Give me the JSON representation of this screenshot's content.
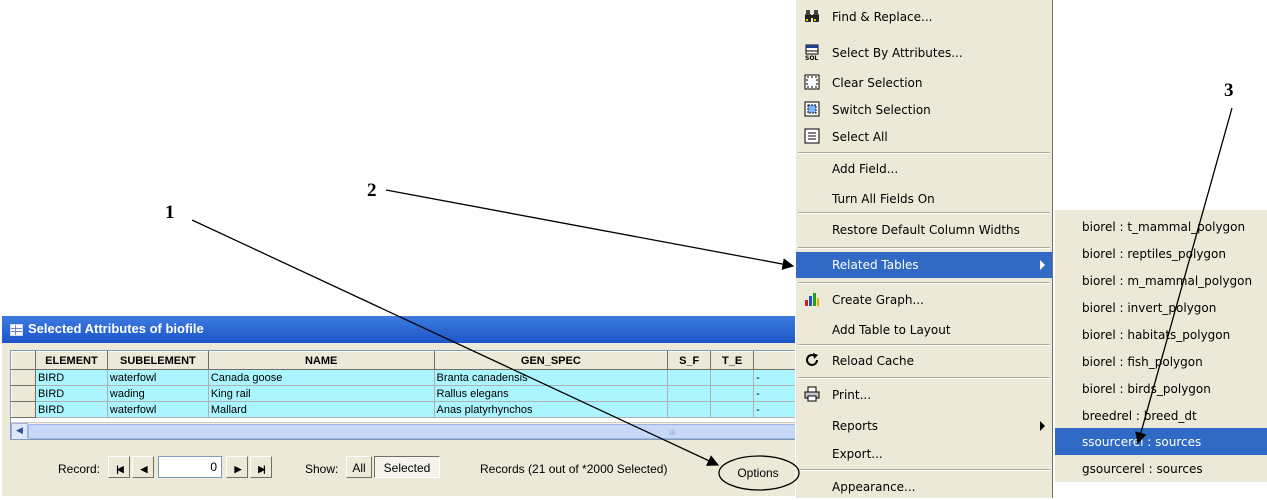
{
  "callouts": {
    "one": "1",
    "two": "2",
    "three": "3"
  },
  "window": {
    "title": "Selected Attributes of biofile",
    "columns": [
      "ELEMENT",
      "SUBELEMENT",
      "NAME",
      "GEN_SPEC",
      "S_F",
      "T_E"
    ],
    "rows": [
      {
        "element": "BIRD",
        "subelement": "waterfowl",
        "name": "Canada goose",
        "gen_spec": "Branta canadensis",
        "s_f": "",
        "t_e": "",
        "extra": "-"
      },
      {
        "element": "BIRD",
        "subelement": "wading",
        "name": "King rail",
        "gen_spec": "Rallus elegans",
        "s_f": "",
        "t_e": "",
        "extra": "-"
      },
      {
        "element": "BIRD",
        "subelement": "waterfowl",
        "name": "Mallard",
        "gen_spec": "Anas platyrhynchos",
        "s_f": "",
        "t_e": "",
        "extra": "-"
      }
    ],
    "scrollbar_grip": "III",
    "nav": {
      "record_label": "Record:",
      "record_value": "0",
      "show_label": "Show:",
      "all_label": "All",
      "selected_label": "Selected",
      "records_status": "Records (21 out of *2000 Selected)",
      "options_label": "Options"
    }
  },
  "menu": {
    "find_replace": "Find & Replace...",
    "select_by_attributes": "Select By Attributes...",
    "clear_selection": "Clear Selection",
    "switch_selection": "Switch Selection",
    "select_all": "Select All",
    "add_field": "Add Field...",
    "turn_all_fields_on": "Turn All Fields On",
    "restore_default_column_widths": "Restore Default Column Widths",
    "related_tables": "Related Tables",
    "create_graph": "Create Graph...",
    "add_table_to_layout": "Add Table to Layout",
    "reload_cache": "Reload Cache",
    "print": "Print...",
    "reports": "Reports",
    "export": "Export...",
    "appearance": "Appearance..."
  },
  "submenu": [
    "biorel : t_mammal_polygon",
    "biorel : reptiles_polygon",
    "biorel : m_mammal_polygon",
    "biorel : invert_polygon",
    "biorel : habitats_polygon",
    "biorel : fish_polygon",
    "biorel : birds_polygon",
    "breedrel : breed_dt",
    "ssourcerel : sources",
    "gsourcerel : sources"
  ],
  "colors": {
    "highlight": "#316ac5",
    "row_fill": "#aaf5ff",
    "menu_bg": "#ece9d8",
    "titlebar": "#1c55c8"
  }
}
